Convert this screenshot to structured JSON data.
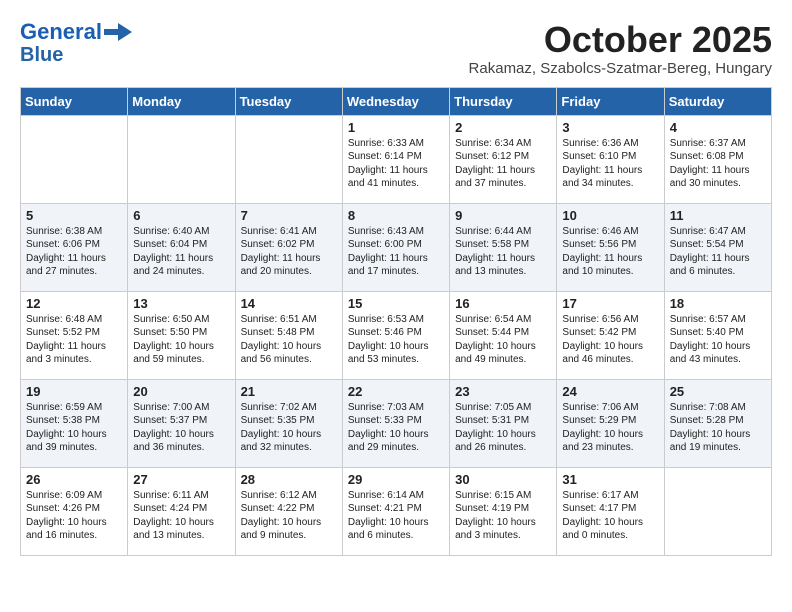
{
  "header": {
    "logo_line1": "General",
    "logo_line2": "Blue",
    "month": "October 2025",
    "location": "Rakamaz, Szabolcs-Szatmar-Bereg, Hungary"
  },
  "weekdays": [
    "Sunday",
    "Monday",
    "Tuesday",
    "Wednesday",
    "Thursday",
    "Friday",
    "Saturday"
  ],
  "weeks": [
    [
      {
        "day": "",
        "text": ""
      },
      {
        "day": "",
        "text": ""
      },
      {
        "day": "",
        "text": ""
      },
      {
        "day": "1",
        "text": "Sunrise: 6:33 AM\nSunset: 6:14 PM\nDaylight: 11 hours\nand 41 minutes."
      },
      {
        "day": "2",
        "text": "Sunrise: 6:34 AM\nSunset: 6:12 PM\nDaylight: 11 hours\nand 37 minutes."
      },
      {
        "day": "3",
        "text": "Sunrise: 6:36 AM\nSunset: 6:10 PM\nDaylight: 11 hours\nand 34 minutes."
      },
      {
        "day": "4",
        "text": "Sunrise: 6:37 AM\nSunset: 6:08 PM\nDaylight: 11 hours\nand 30 minutes."
      }
    ],
    [
      {
        "day": "5",
        "text": "Sunrise: 6:38 AM\nSunset: 6:06 PM\nDaylight: 11 hours\nand 27 minutes."
      },
      {
        "day": "6",
        "text": "Sunrise: 6:40 AM\nSunset: 6:04 PM\nDaylight: 11 hours\nand 24 minutes."
      },
      {
        "day": "7",
        "text": "Sunrise: 6:41 AM\nSunset: 6:02 PM\nDaylight: 11 hours\nand 20 minutes."
      },
      {
        "day": "8",
        "text": "Sunrise: 6:43 AM\nSunset: 6:00 PM\nDaylight: 11 hours\nand 17 minutes."
      },
      {
        "day": "9",
        "text": "Sunrise: 6:44 AM\nSunset: 5:58 PM\nDaylight: 11 hours\nand 13 minutes."
      },
      {
        "day": "10",
        "text": "Sunrise: 6:46 AM\nSunset: 5:56 PM\nDaylight: 11 hours\nand 10 minutes."
      },
      {
        "day": "11",
        "text": "Sunrise: 6:47 AM\nSunset: 5:54 PM\nDaylight: 11 hours\nand 6 minutes."
      }
    ],
    [
      {
        "day": "12",
        "text": "Sunrise: 6:48 AM\nSunset: 5:52 PM\nDaylight: 11 hours\nand 3 minutes."
      },
      {
        "day": "13",
        "text": "Sunrise: 6:50 AM\nSunset: 5:50 PM\nDaylight: 10 hours\nand 59 minutes."
      },
      {
        "day": "14",
        "text": "Sunrise: 6:51 AM\nSunset: 5:48 PM\nDaylight: 10 hours\nand 56 minutes."
      },
      {
        "day": "15",
        "text": "Sunrise: 6:53 AM\nSunset: 5:46 PM\nDaylight: 10 hours\nand 53 minutes."
      },
      {
        "day": "16",
        "text": "Sunrise: 6:54 AM\nSunset: 5:44 PM\nDaylight: 10 hours\nand 49 minutes."
      },
      {
        "day": "17",
        "text": "Sunrise: 6:56 AM\nSunset: 5:42 PM\nDaylight: 10 hours\nand 46 minutes."
      },
      {
        "day": "18",
        "text": "Sunrise: 6:57 AM\nSunset: 5:40 PM\nDaylight: 10 hours\nand 43 minutes."
      }
    ],
    [
      {
        "day": "19",
        "text": "Sunrise: 6:59 AM\nSunset: 5:38 PM\nDaylight: 10 hours\nand 39 minutes."
      },
      {
        "day": "20",
        "text": "Sunrise: 7:00 AM\nSunset: 5:37 PM\nDaylight: 10 hours\nand 36 minutes."
      },
      {
        "day": "21",
        "text": "Sunrise: 7:02 AM\nSunset: 5:35 PM\nDaylight: 10 hours\nand 32 minutes."
      },
      {
        "day": "22",
        "text": "Sunrise: 7:03 AM\nSunset: 5:33 PM\nDaylight: 10 hours\nand 29 minutes."
      },
      {
        "day": "23",
        "text": "Sunrise: 7:05 AM\nSunset: 5:31 PM\nDaylight: 10 hours\nand 26 minutes."
      },
      {
        "day": "24",
        "text": "Sunrise: 7:06 AM\nSunset: 5:29 PM\nDaylight: 10 hours\nand 23 minutes."
      },
      {
        "day": "25",
        "text": "Sunrise: 7:08 AM\nSunset: 5:28 PM\nDaylight: 10 hours\nand 19 minutes."
      }
    ],
    [
      {
        "day": "26",
        "text": "Sunrise: 6:09 AM\nSunset: 4:26 PM\nDaylight: 10 hours\nand 16 minutes."
      },
      {
        "day": "27",
        "text": "Sunrise: 6:11 AM\nSunset: 4:24 PM\nDaylight: 10 hours\nand 13 minutes."
      },
      {
        "day": "28",
        "text": "Sunrise: 6:12 AM\nSunset: 4:22 PM\nDaylight: 10 hours\nand 9 minutes."
      },
      {
        "day": "29",
        "text": "Sunrise: 6:14 AM\nSunset: 4:21 PM\nDaylight: 10 hours\nand 6 minutes."
      },
      {
        "day": "30",
        "text": "Sunrise: 6:15 AM\nSunset: 4:19 PM\nDaylight: 10 hours\nand 3 minutes."
      },
      {
        "day": "31",
        "text": "Sunrise: 6:17 AM\nSunset: 4:17 PM\nDaylight: 10 hours\nand 0 minutes."
      },
      {
        "day": "",
        "text": ""
      }
    ]
  ]
}
